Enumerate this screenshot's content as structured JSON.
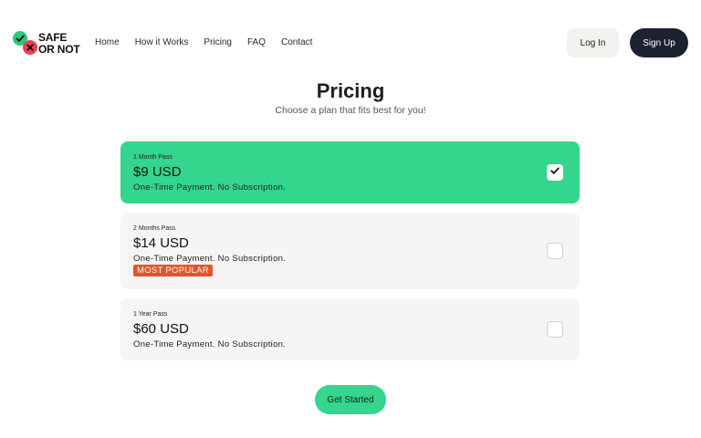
{
  "brand": {
    "line1": "SAFE",
    "line2": "OR NOT"
  },
  "nav": {
    "items": [
      {
        "label": "Home"
      },
      {
        "label": "How it Works"
      },
      {
        "label": "Pricing"
      },
      {
        "label": "FAQ"
      },
      {
        "label": "Contact"
      }
    ]
  },
  "auth": {
    "login_label": "Log In",
    "signup_label": "Sign Up"
  },
  "page": {
    "title": "Pricing",
    "subtitle": "Choose a plan that fits best for you!"
  },
  "plans": [
    {
      "name": "1 Month Pass",
      "price": "$9 USD",
      "description": "One-Time Payment. No Subscription.",
      "selected": true
    },
    {
      "name": "2 Months Pass",
      "price": "$14 USD",
      "description": "One-Time Payment. No Subscription.",
      "badge": "MOST POPULAR",
      "selected": false
    },
    {
      "name": "1 Year Pass",
      "price": "$60 USD",
      "description": "One-Time Payment. No Subscription.",
      "selected": false
    }
  ],
  "cta": {
    "label": "Get Started"
  },
  "icons": {
    "logo_check": "check-circle-icon",
    "logo_x": "x-circle-icon",
    "plan_check": "checkmark-icon"
  },
  "colors": {
    "accent_green": "#34d58c",
    "badge_orange": "#e2552b",
    "dark_button": "#1c2230",
    "logo_red": "#e6424f"
  }
}
